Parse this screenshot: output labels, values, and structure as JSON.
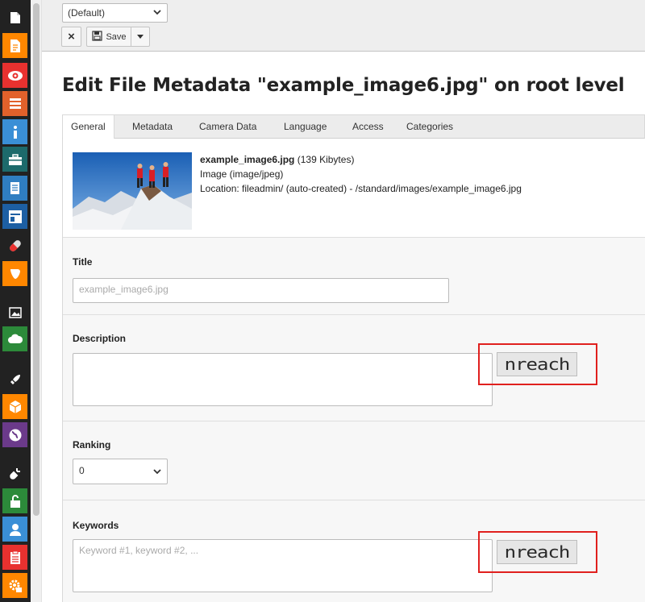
{
  "docheader": {
    "language_select": "(Default)",
    "close_label": "×",
    "save_label": "Save"
  },
  "page_title": "Edit File Metadata \"example_image6.jpg\" on root level",
  "tabs": [
    {
      "label": "General"
    },
    {
      "label": "Metadata"
    },
    {
      "label": "Camera Data"
    },
    {
      "label": "Language"
    },
    {
      "label": "Access"
    },
    {
      "label": "Categories"
    }
  ],
  "file_info": {
    "filename": "example_image6.jpg",
    "size": "(139 Kibytes)",
    "type": "Image (image/jpeg)",
    "location": "Location: fileadmin/ (auto-created) - /standard/images/example_image6.jpg"
  },
  "fields": {
    "title": {
      "label": "Title",
      "placeholder": "example_image6.jpg"
    },
    "description": {
      "label": "Description",
      "value": ""
    },
    "ranking": {
      "label": "Ranking",
      "value": "0"
    },
    "keywords": {
      "label": "Keywords",
      "placeholder": "Keyword #1, keyword #2, ..."
    }
  },
  "nreach_logo_text": "nreach",
  "colors": {
    "modbar_bg": "#222222",
    "highlight_red": "#e0201e",
    "orange": "#ff8700"
  }
}
